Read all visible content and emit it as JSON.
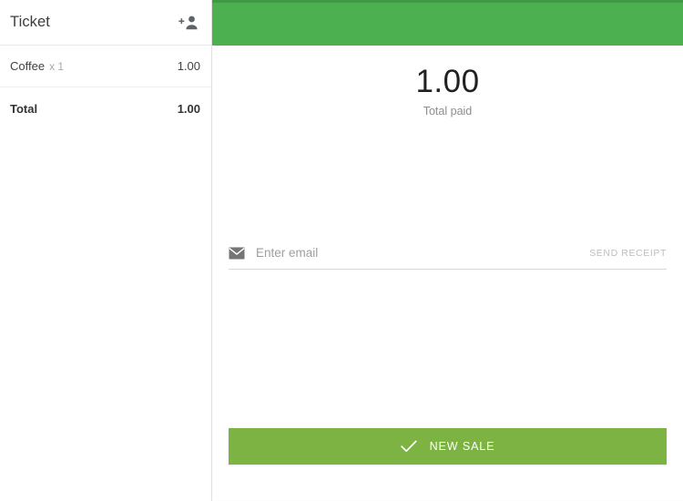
{
  "colors": {
    "app_bar_green": "#4caf50",
    "status_strip_green": "#409a44",
    "new_sale_green": "#7cb342",
    "divider_gray": "#e0e0e0",
    "muted_text": "#9e9e9e"
  },
  "ticket": {
    "title": "Ticket",
    "add_customer_icon": "person-add-icon",
    "items": [
      {
        "name": "Coffee",
        "quantity_label": "x 1",
        "amount": "1.00"
      }
    ],
    "total": {
      "label": "Total",
      "amount": "1.00"
    }
  },
  "payment": {
    "amount": "1.00",
    "caption": "Total paid"
  },
  "receipt": {
    "mail_icon": "mail-icon",
    "email_value": "",
    "email_placeholder": "Enter email",
    "send_label": "SEND RECEIPT"
  },
  "actions": {
    "new_sale_label": "NEW SALE",
    "new_sale_icon": "check-icon"
  }
}
